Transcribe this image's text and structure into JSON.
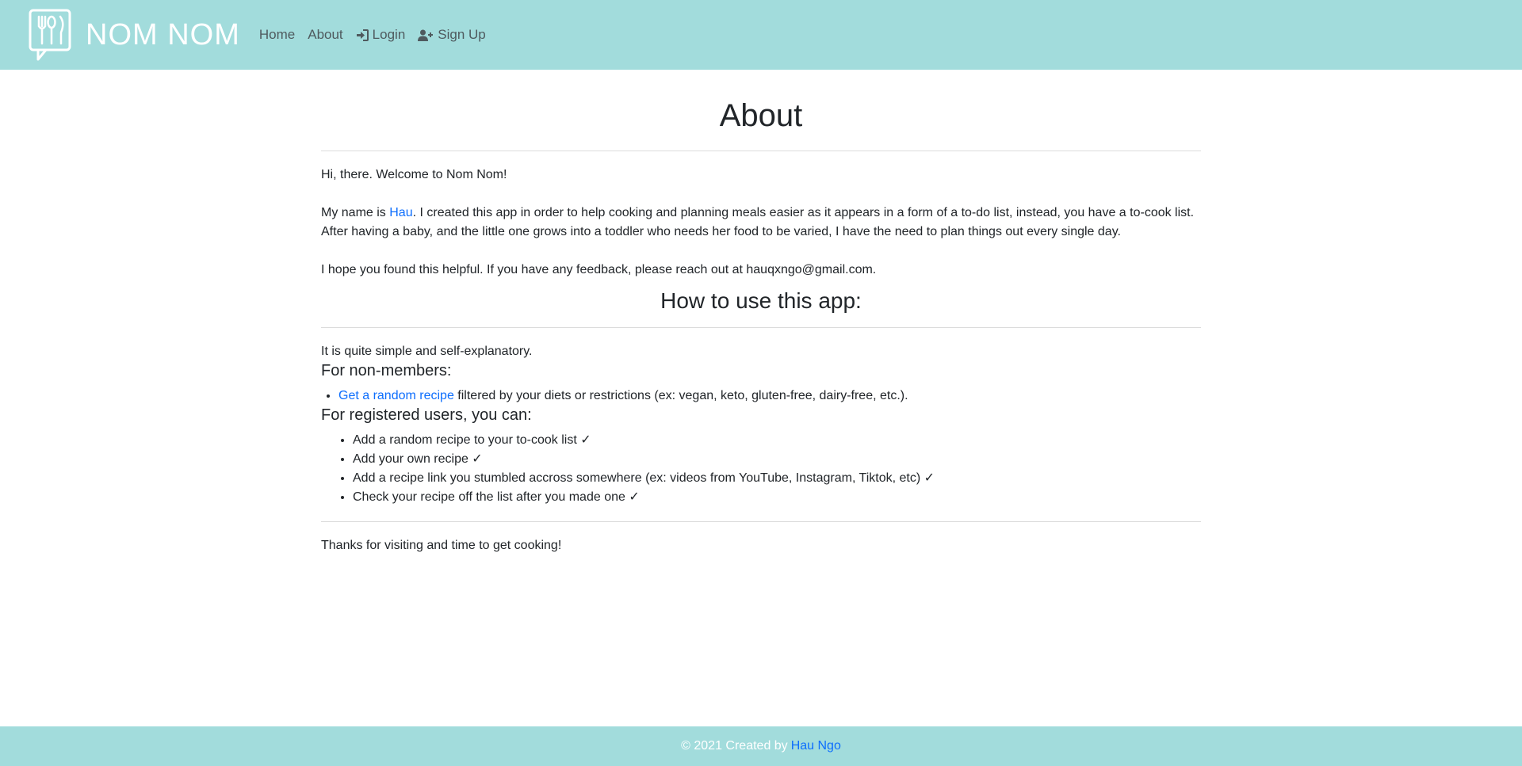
{
  "navbar": {
    "brand": "NOM NOM",
    "logo_icon": "fork-spoon-knife-icon",
    "links": [
      {
        "label": "Home",
        "icon": null
      },
      {
        "label": "About",
        "icon": null
      },
      {
        "label": "Login",
        "icon": "sign-in-icon"
      },
      {
        "label": "Sign Up",
        "icon": "user-plus-icon"
      }
    ],
    "background": "#a2dcdc"
  },
  "about": {
    "title": "About",
    "greeting": "Hi, there. Welcome to Nom Nom!",
    "intro_prefix": "My name is ",
    "intro_link": "Hau",
    "intro_suffix": ". I created this app in order to help cooking and planning meals easier as it appears in a form of a to-do list, instead, you have a to-cook list. After having a baby, and the little one grows into a toddler who needs her food to be varied, I have the need to plan things out every single day.",
    "feedback": "I hope you found this helpful. If you have any feedback, please reach out at hauqxngo@gmail.com."
  },
  "howto": {
    "title": "How to use this app:",
    "intro": "It is quite simple and self-explanatory.",
    "non_members_heading": "For non-members:",
    "non_members_items": [
      {
        "link": "Get a random recipe",
        "text": " filtered by your diets or restrictions (ex: vegan, keto, gluten-free, dairy-free, etc.)."
      }
    ],
    "registered_heading": "For registered users, you can:",
    "registered_items": [
      "Add a random recipe to your to-cook list ✓",
      "Add your own recipe ✓",
      "Add a recipe link you stumbled accross somewhere (ex: videos from YouTube, Instagram, Tiktok, etc) ✓",
      "Check your recipe off the list after you made one ✓"
    ]
  },
  "closing": "Thanks for visiting and time to get cooking!",
  "footer": {
    "text": "© 2021 Created by",
    "link": "Hau Ngo"
  },
  "colors": {
    "accent": "#a2dcdc",
    "link": "#0d6efd"
  }
}
